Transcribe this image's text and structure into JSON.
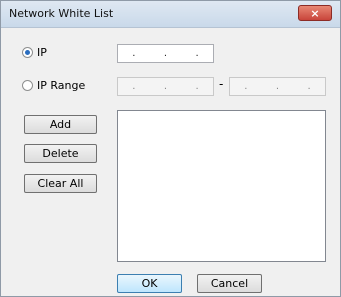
{
  "window": {
    "title": "Network White List",
    "close_label": "×"
  },
  "options": {
    "ip_label": "IP",
    "ip_range_label": "IP Range",
    "selected": "IP"
  },
  "ip_field": {
    "separators": [
      ".",
      ".",
      "."
    ]
  },
  "range_start": {
    "separators": [
      ".",
      ".",
      "."
    ]
  },
  "range_dash": "-",
  "range_end": {
    "separators": [
      ".",
      ".",
      "."
    ]
  },
  "buttons": {
    "add": "Add",
    "delete": "Delete",
    "clear_all": "Clear All",
    "ok": "OK",
    "cancel": "Cancel"
  },
  "white_list": {
    "items": []
  }
}
